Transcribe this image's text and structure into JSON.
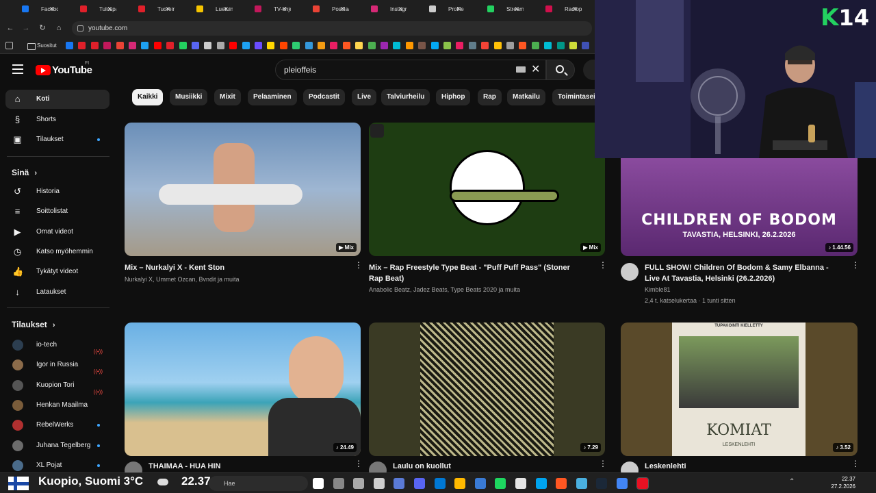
{
  "browser": {
    "tabs": [
      {
        "label": "Facebook",
        "color": "#1877f2"
      },
      {
        "label": "Tulospalvelu",
        "color": "#e0202a"
      },
      {
        "label": "Tuoreimmat",
        "color": "#e0202a"
      },
      {
        "label": "Luetuimmat",
        "color": "#f5c400"
      },
      {
        "label": "TV-ohjelmat",
        "color": "#c2185b"
      },
      {
        "label": "Postilaatikko",
        "color": "#ea4335"
      },
      {
        "label": "Instagram",
        "color": "#d62976"
      },
      {
        "label": "Profile | Bo",
        "color": "#cccccc"
      },
      {
        "label": "Stream - K",
        "color": "#23d160"
      },
      {
        "label": "Radioplay",
        "color": "#d0104c"
      }
    ],
    "url": "youtube.com",
    "bookmarks_folder": "Suositut"
  },
  "youtube": {
    "logo_text": "YouTube",
    "country_code": "FI",
    "search_value": "pleioffeis"
  },
  "sidebar": {
    "main": [
      {
        "label": "Koti",
        "icon": "home-icon"
      },
      {
        "label": "Shorts",
        "icon": "shorts-icon"
      },
      {
        "label": "Tilaukset",
        "icon": "subscriptions-icon"
      }
    ],
    "you_heading": "Sinä",
    "you_items": [
      {
        "label": "Historia",
        "icon": "history-icon"
      },
      {
        "label": "Soittolistat",
        "icon": "playlists-icon"
      },
      {
        "label": "Omat videot",
        "icon": "your-videos-icon"
      },
      {
        "label": "Katso myöhemmin",
        "icon": "watch-later-icon"
      },
      {
        "label": "Tykätyt videot",
        "icon": "liked-icon"
      },
      {
        "label": "Lataukset",
        "icon": "downloads-icon"
      }
    ],
    "subs_heading": "Tilaukset",
    "subscriptions": [
      {
        "label": "io-tech",
        "status": "live",
        "color": "#2c3e50"
      },
      {
        "label": "Igor in Russia",
        "status": "live",
        "color": "#8b6b4a"
      },
      {
        "label": "Kuopion Tori",
        "status": "live",
        "color": "#555555"
      },
      {
        "label": "Henkan Maailma",
        "status": "none",
        "color": "#7a5c3a"
      },
      {
        "label": "RebelWerks",
        "status": "new",
        "color": "#b03030"
      },
      {
        "label": "Juhana Tegelberg",
        "status": "new",
        "color": "#6b6b6b"
      },
      {
        "label": "XL Pojat",
        "status": "new",
        "color": "#4a6b8a"
      }
    ]
  },
  "chips": [
    "Kaikki",
    "Musiikki",
    "Mixit",
    "Pelaaminen",
    "Podcastit",
    "Live",
    "Talviurheilu",
    "Hiphop",
    "Rap",
    "Matkailu",
    "Toimintasei"
  ],
  "videos": [
    {
      "title": "Mix – Nurkalyi X - Kent Ston",
      "meta1": "Nurkalyi X, Ummet Ozcan, Bvndit ja muita",
      "meta2": "",
      "badge": "Mix",
      "thumb": "#5b7fa6"
    },
    {
      "title": "Mix – Rap Freestyle Type Beat - \"Puff Puff Pass\" (Stoner Rap Beat)",
      "meta1": "Anabolic Beatz, Jadez Beats, Type Beats 2020 ja muita",
      "meta2": "",
      "badge": "Mix",
      "thumb": "#1e3d12"
    },
    {
      "title": "FULL SHOW! Children Of Bodom & Samy Elbanna - Live At Tavastia, Helsinki (26.2.2026)",
      "meta1": "Kimble81",
      "meta2": "2,4 t. katselukertaa · 1 tunti sitten",
      "badge": "1.44.56",
      "thumb": "#6b2a7a",
      "overlay1": "CHILDREN OF BODOM",
      "overlay2": "TAVASTIA, HELSINKI, 26.2.2026"
    },
    {
      "title": "THAIMAA - HUA HIN",
      "meta1": "",
      "meta2": "",
      "badge": "24.49",
      "thumb": "#5a9fd4"
    },
    {
      "title": "Laulu on kuollut",
      "meta1": "",
      "meta2": "",
      "badge": "7.29",
      "thumb": "#3a3a24"
    },
    {
      "title": "Leskenlehti",
      "meta1": "",
      "meta2": "",
      "badge": "3.52",
      "thumb": "#5a4a2a",
      "overlay1": "KOMIAT",
      "overlay2": "LESKENLEHTI",
      "overlay3": "TUPAKOINTI KIELLETTY"
    }
  ],
  "webcam": {
    "logo_letter": "K",
    "logo_number": "14"
  },
  "taskbar": {
    "weather": "Kuopio, Suomi 3°C",
    "weather_time": "22.37",
    "search_placeholder": "Hae",
    "clock_time": "22.37",
    "clock_date": "27.2.2026"
  }
}
